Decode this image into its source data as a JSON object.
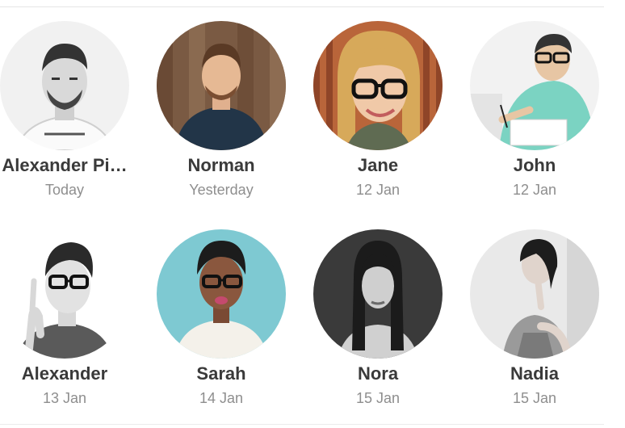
{
  "contacts": [
    {
      "name": "Alexander Pi…",
      "date": "Today"
    },
    {
      "name": "Norman",
      "date": "Yesterday"
    },
    {
      "name": "Jane",
      "date": "12 Jan"
    },
    {
      "name": "John",
      "date": "12 Jan"
    },
    {
      "name": "Alexander",
      "date": "13 Jan"
    },
    {
      "name": "Sarah",
      "date": "14 Jan"
    },
    {
      "name": "Nora",
      "date": "15 Jan"
    },
    {
      "name": "Nadia",
      "date": "15 Jan"
    }
  ]
}
